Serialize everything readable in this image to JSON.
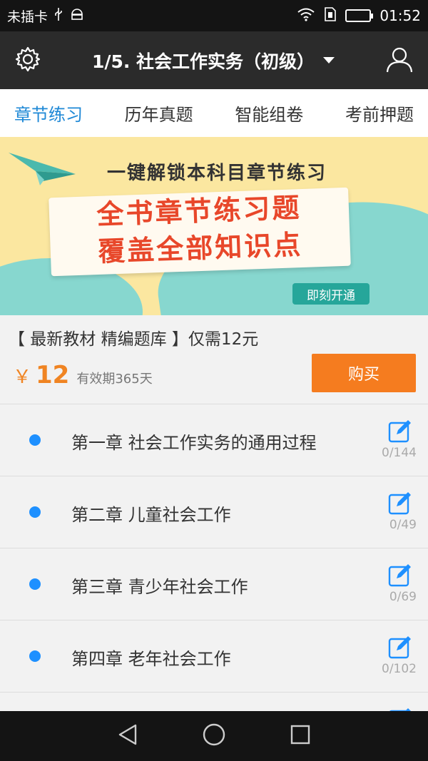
{
  "status_bar": {
    "carrier": "未插卡",
    "time": "01:52"
  },
  "header": {
    "title": "1/5. 社会工作实务（初级）"
  },
  "tabs": [
    {
      "label": "章节练习",
      "active": true
    },
    {
      "label": "历年真题",
      "active": false
    },
    {
      "label": "智能组卷",
      "active": false
    },
    {
      "label": "考前押题",
      "active": false
    }
  ],
  "banner": {
    "tagline": "一键解锁本科目章节练习",
    "headline_1": "全书章节练习题",
    "headline_2": "覆盖全部知识点",
    "open_label": "即刻开通"
  },
  "promo": {
    "description": "【 最新教材 精编题库 】仅需12元",
    "currency": "￥",
    "price": "12",
    "validity": "有效期365天",
    "buy_label": "购买"
  },
  "chapters": [
    {
      "name": "第一章 社会工作实务的通用过程",
      "count": "0/144"
    },
    {
      "name": "第二章 儿童社会工作",
      "count": "0/49"
    },
    {
      "name": "第三章 青少年社会工作",
      "count": "0/69"
    },
    {
      "name": "第四章 老年社会工作",
      "count": "0/102"
    }
  ],
  "colors": {
    "accent": "#1e88d6",
    "buy": "#f57c1f",
    "price": "#f08422"
  }
}
